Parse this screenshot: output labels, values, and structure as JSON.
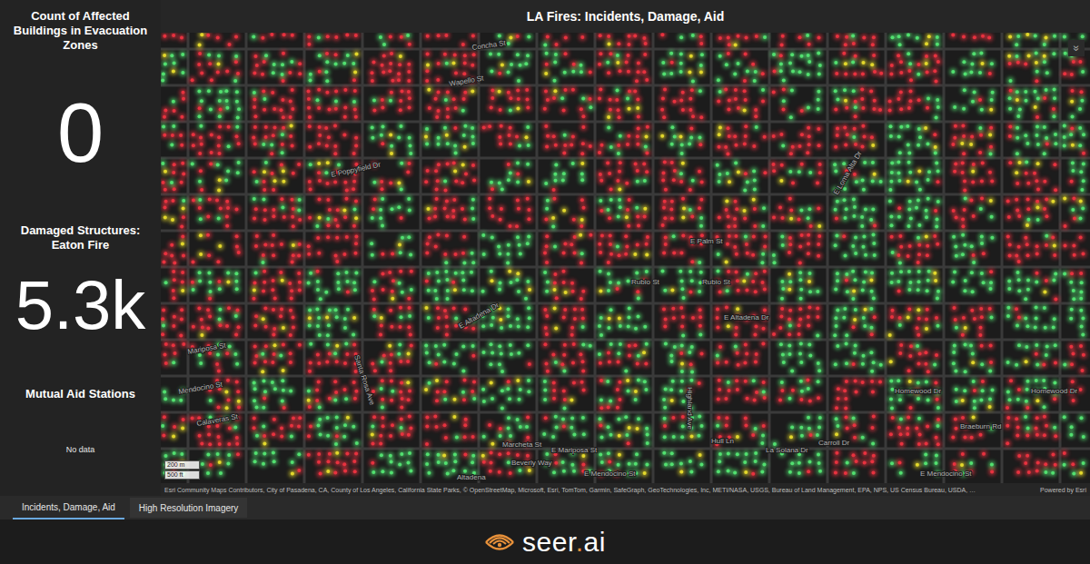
{
  "header": {
    "title": "LA Fires: Incidents, Damage, Aid"
  },
  "sidebar": {
    "stats": [
      {
        "label": "Count of Affected Buildings in Evacuation Zones",
        "value": "0",
        "kind": "number"
      },
      {
        "label": "Damaged Structures: Eaton Fire",
        "value": "5.3k",
        "kind": "number"
      },
      {
        "label": "Mutual Aid Stations",
        "value": "No data",
        "kind": "empty"
      }
    ]
  },
  "map": {
    "collapse_icon": "»",
    "street_labels": [
      "Concha St",
      "Wapello St",
      "E Poppyfield Dr",
      "E Loma Alta Dr",
      "E Palm St",
      "Rubio St",
      "Rubio St",
      "E Altadena Dr",
      "E Altadena Dr",
      "Santa Rosa Ave",
      "Mariposa St",
      "Mendocino St",
      "Calaveras St",
      "Highland Ave",
      "Homewood Dr",
      "Homewood Dr",
      "Braeburn Rd",
      "Marcheta St",
      "E Mariposa St",
      "Beverly Way",
      "Hull Ln",
      "La Solana Dr",
      "Carroll Dr",
      "E Mendocino St",
      "E Mendocino St",
      "Altadena"
    ],
    "scale": [
      "200 m",
      "500 ft"
    ],
    "categories": [
      {
        "kind": "destroyed",
        "color": "#e8323f"
      },
      {
        "kind": "damaged",
        "color": "#e3d82c"
      },
      {
        "kind": "no-damage",
        "color": "#52e070"
      }
    ],
    "damaged_share": 0.08,
    "damage_grid": [
      [
        0.9,
        0.95,
        0.95,
        0.9,
        0.7,
        0.4,
        0.6,
        0.5,
        0.3,
        0.5,
        0.3,
        0.2
      ],
      [
        0.9,
        0.9,
        0.95,
        0.9,
        0.6,
        0.3,
        0.7,
        0.6,
        0.5,
        0.6,
        0.4,
        0.3
      ],
      [
        0.85,
        0.9,
        0.9,
        0.8,
        0.3,
        0.6,
        0.8,
        0.6,
        0.6,
        0.5,
        0.5,
        0.4
      ],
      [
        0.8,
        0.85,
        0.7,
        0.5,
        0.5,
        0.8,
        0.6,
        0.5,
        0.6,
        0.7,
        0.6,
        0.5
      ],
      [
        0.5,
        0.6,
        0.5,
        0.6,
        0.5,
        0.7,
        0.4,
        0.5,
        0.6,
        0.6,
        0.6,
        0.5
      ],
      [
        0.2,
        0.3,
        0.5,
        0.6,
        0.4,
        0.3,
        0.4,
        0.5,
        0.6,
        0.6,
        0.7,
        0.6
      ]
    ],
    "attribution": "Esri Community Maps Contributors, City of Pasadena, CA, County of Los Angeles, California State Parks, © OpenStreetMap, Microsoft, Esri, TomTom, Garmin, SafeGraph, GeoTechnologies, Inc, METI/NASA, USGS, Bureau of Land Management, EPA, NPS, US Census Bureau, USDA, …",
    "powered_by": "Powered by Esri"
  },
  "tabs": [
    {
      "label": "Incidents, Damage, Aid",
      "selected": true
    },
    {
      "label": "High Resolution Imagery",
      "selected": false
    }
  ],
  "footer": {
    "logo": [
      {
        "text": "seer",
        "color": "#ffffff"
      },
      {
        "text": ".",
        "color": "#e8913a"
      },
      {
        "text": "ai",
        "color": "#ffffff"
      }
    ]
  }
}
